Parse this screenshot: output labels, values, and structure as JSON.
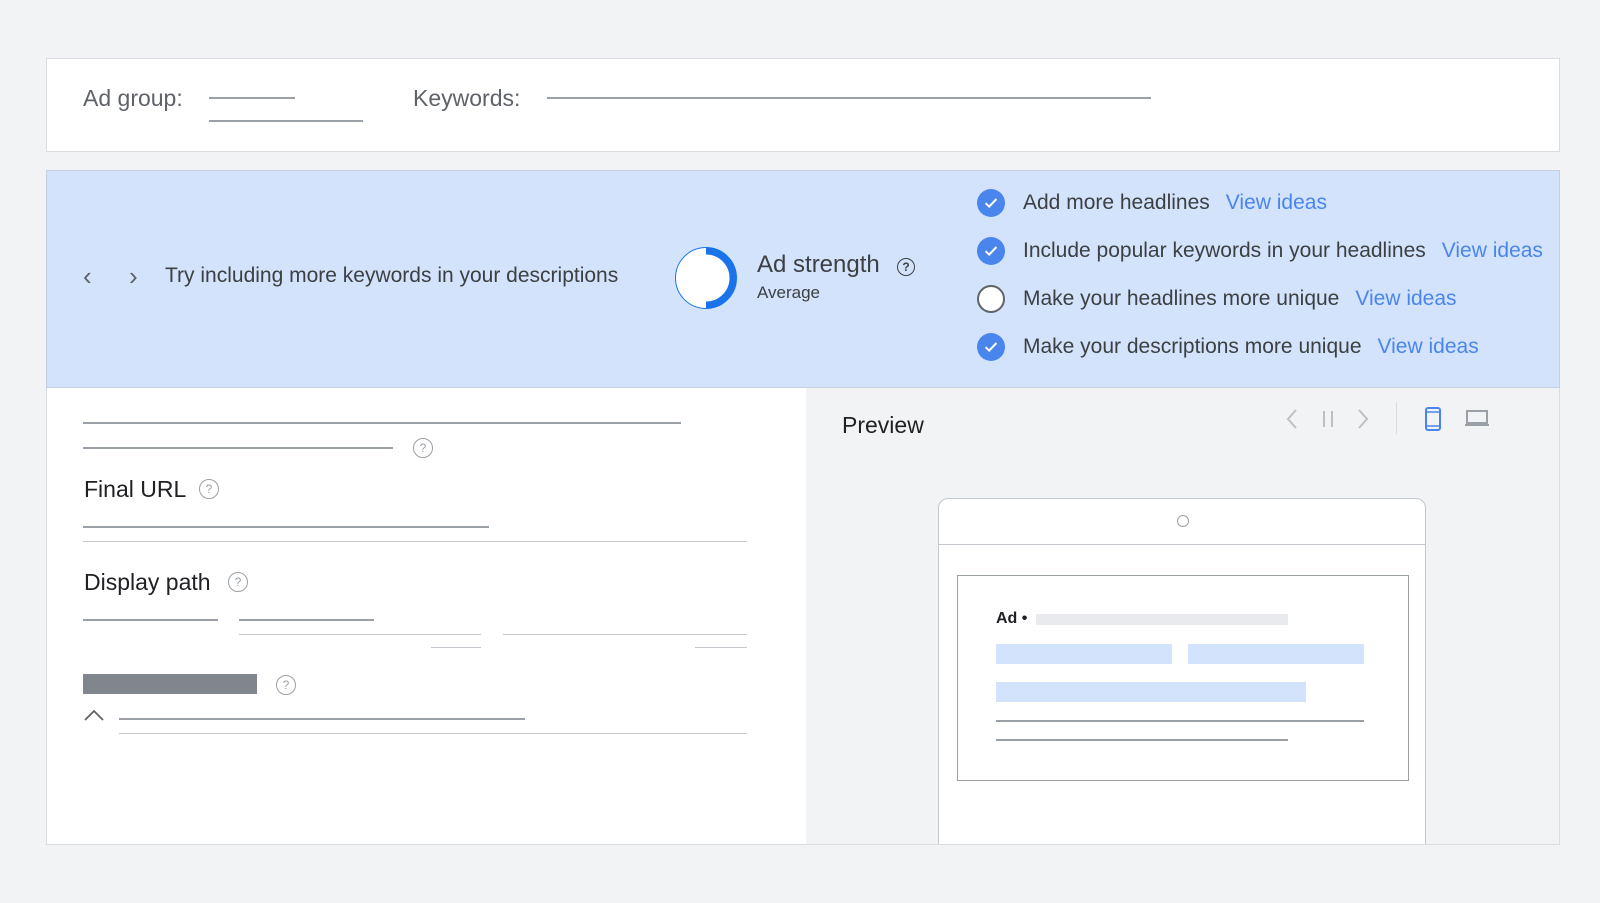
{
  "top_bar": {
    "ad_group_label": "Ad group:",
    "keywords_label": "Keywords:"
  },
  "banner": {
    "prev_icon": "chevron-left-icon",
    "next_icon": "chevron-right-icon",
    "tip": "Try including more keywords in your descriptions",
    "ad_strength": {
      "title": "Ad strength",
      "help": "?",
      "value": "Average",
      "level_fraction": 0.5,
      "color": "#1a73e8"
    },
    "checklist": [
      {
        "text": "Add more headlines",
        "link": "View ideas",
        "checked": true
      },
      {
        "text": "Include popular keywords in your headlines",
        "link": "View ideas",
        "checked": true
      },
      {
        "text": "Make your headlines more unique",
        "link": "View ideas",
        "checked": false
      },
      {
        "text": "Make your descriptions more unique",
        "link": "View ideas",
        "checked": true
      }
    ]
  },
  "form": {
    "final_url_label": "Final URL",
    "display_path_label": "Display path",
    "help": "?"
  },
  "preview": {
    "title": "Preview",
    "ad_label": "Ad •",
    "toolbar_icons": [
      "chevron-left-icon",
      "pause-icon",
      "chevron-right-icon",
      "mobile-icon",
      "desktop-icon"
    ]
  },
  "colors": {
    "accent": "#4a85ee",
    "banner_bg": "#d3e3fb",
    "page_bg": "#f1f3f4"
  }
}
